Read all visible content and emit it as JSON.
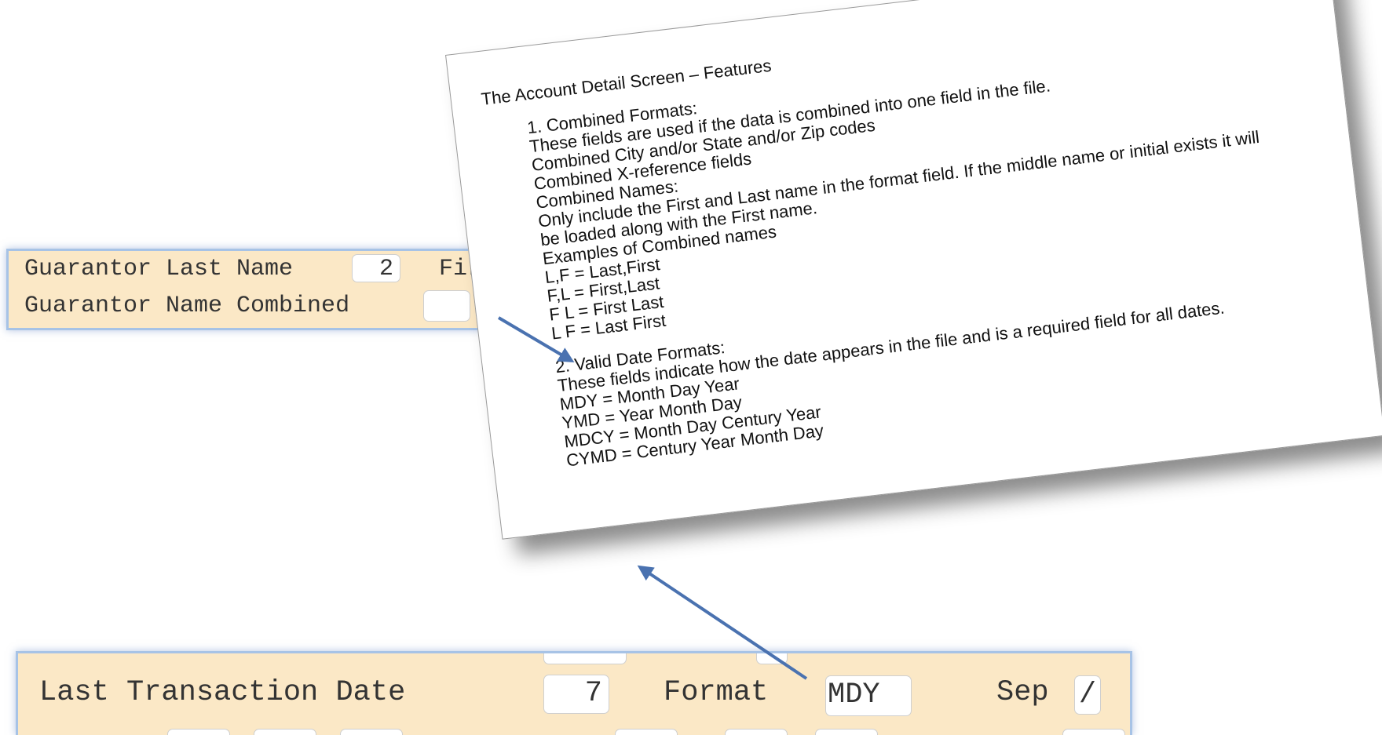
{
  "top_form": {
    "row1_label": "Guarantor Last Name",
    "row1_value": "2",
    "row1_next_label": "First",
    "row2_label": "Guarantor Name Combined",
    "row2_value": ""
  },
  "document": {
    "title": "The Account Detail Screen – Features",
    "sec1_heading": "1.  Combined Formats:",
    "sec1_desc": "These fields are used if the data is combined into one field in the file.",
    "combined_city": "Combined City and/or State and/or Zip codes",
    "combined_xref": "Combined X-reference fields",
    "combined_names": "Combined Names:",
    "names_note_1": "Only include the First and Last name in the format field. If the middle name or initial exists it will",
    "names_note_2": "be loaded along with the First name.",
    "examples_heading": "Examples of Combined names",
    "ex1": "L,F = Last,First",
    "ex2": "F,L = First,Last",
    "ex3": "F L = First Last",
    "ex4": "L F = Last First",
    "sec2_heading": "2.  Valid Date Formats:",
    "sec2_desc": "These fields indicate how the date appears in the file and is a required field for all dates.",
    "d1": "MDY = Month Day Year",
    "d2": "YMD = Year Month Day",
    "d3": "MDCY = Month Day Century Year",
    "d4": "CYMD = Century Year Month Day"
  },
  "bottom_form": {
    "label": "Last Transaction Date",
    "position_value": "7",
    "format_label": "Format",
    "format_value": "MDY",
    "sep_label": "Sep",
    "sep_value": "/"
  },
  "colors": {
    "form_bg": "#fbe8c6",
    "form_border": "#a7c3e6",
    "arrow": "#4a72b0"
  }
}
